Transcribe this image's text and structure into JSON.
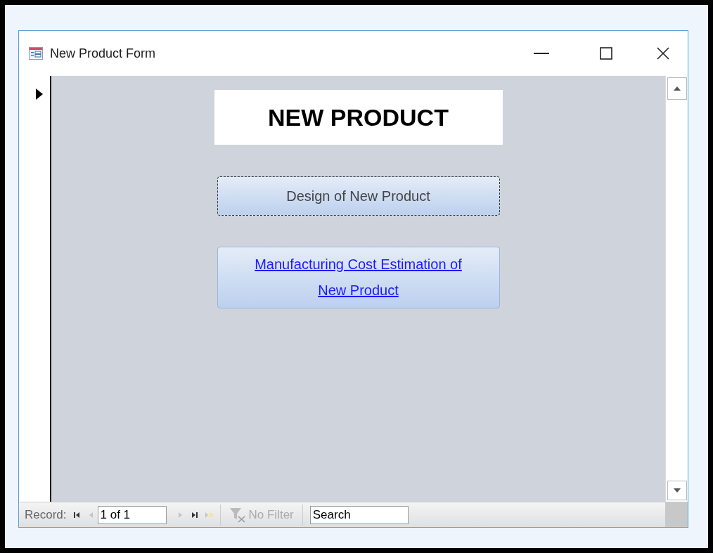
{
  "window": {
    "title": "New Product Form"
  },
  "form": {
    "title": "NEW PRODUCT",
    "buttons": [
      {
        "label": "Design of New Product",
        "kind": "command",
        "focused": true
      },
      {
        "label": "Manufacturing Cost Estimation of New Product",
        "kind": "hyperlink",
        "focused": false
      }
    ]
  },
  "navigation": {
    "label": "Record:",
    "position": "1 of 1",
    "buttons_before": [
      {
        "kind": "first",
        "disabled": false
      },
      {
        "kind": "previous",
        "disabled": true
      }
    ],
    "buttons_after": [
      {
        "kind": "next",
        "disabled": true
      },
      {
        "kind": "last",
        "disabled": false
      },
      {
        "kind": "new",
        "disabled": true
      }
    ],
    "filter": {
      "label": "No Filter",
      "disabled": true
    },
    "search": {
      "placeholder": "Search"
    }
  }
}
